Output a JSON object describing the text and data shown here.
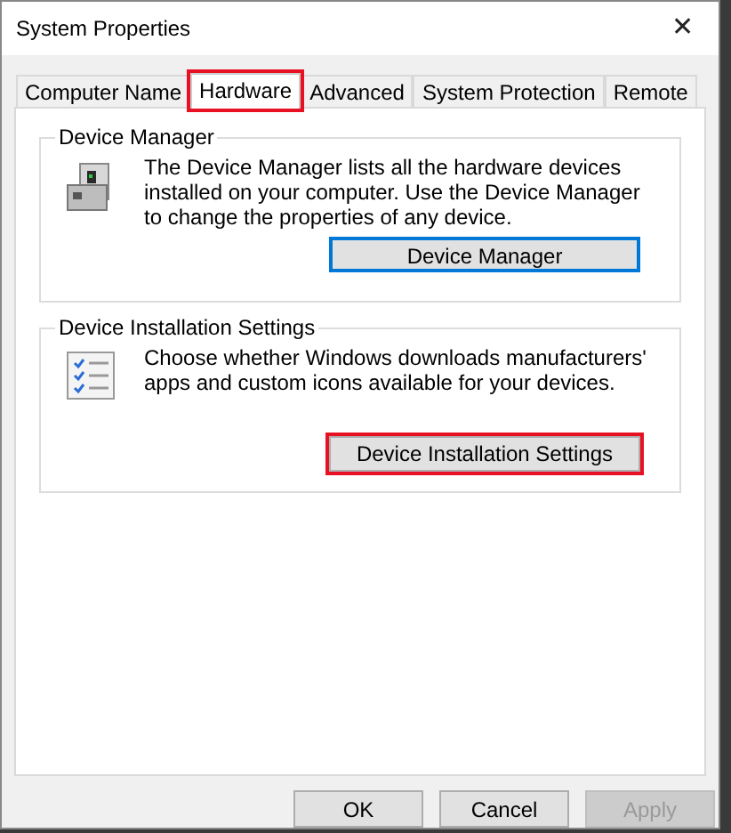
{
  "window": {
    "title": "System Properties",
    "close": "✕"
  },
  "tabs": [
    {
      "label": "Computer Name",
      "selected": false,
      "highlighted": false
    },
    {
      "label": "Hardware",
      "selected": true,
      "highlighted": true
    },
    {
      "label": "Advanced",
      "selected": false,
      "highlighted": false
    },
    {
      "label": "System Protection",
      "selected": false,
      "highlighted": false
    },
    {
      "label": "Remote",
      "selected": false,
      "highlighted": false
    }
  ],
  "groups": [
    {
      "title": "Device Manager",
      "kind": "device",
      "text": "The Device Manager lists all the hardware devices installed on your computer. Use the Device Manager to change the properties of any device.",
      "button": {
        "label": "Device Manager",
        "focused": true,
        "highlighted": false
      }
    },
    {
      "title": "Device Installation Settings",
      "kind": "checklist",
      "text": "Choose whether Windows downloads manufacturers' apps and custom icons available for your devices.",
      "button": {
        "label": "Device Installation Settings",
        "focused": false,
        "highlighted": true
      }
    }
  ],
  "buttons": [
    {
      "label": "OK",
      "disabled": false
    },
    {
      "label": "Cancel",
      "disabled": false
    },
    {
      "label": "Apply",
      "disabled": true
    }
  ]
}
